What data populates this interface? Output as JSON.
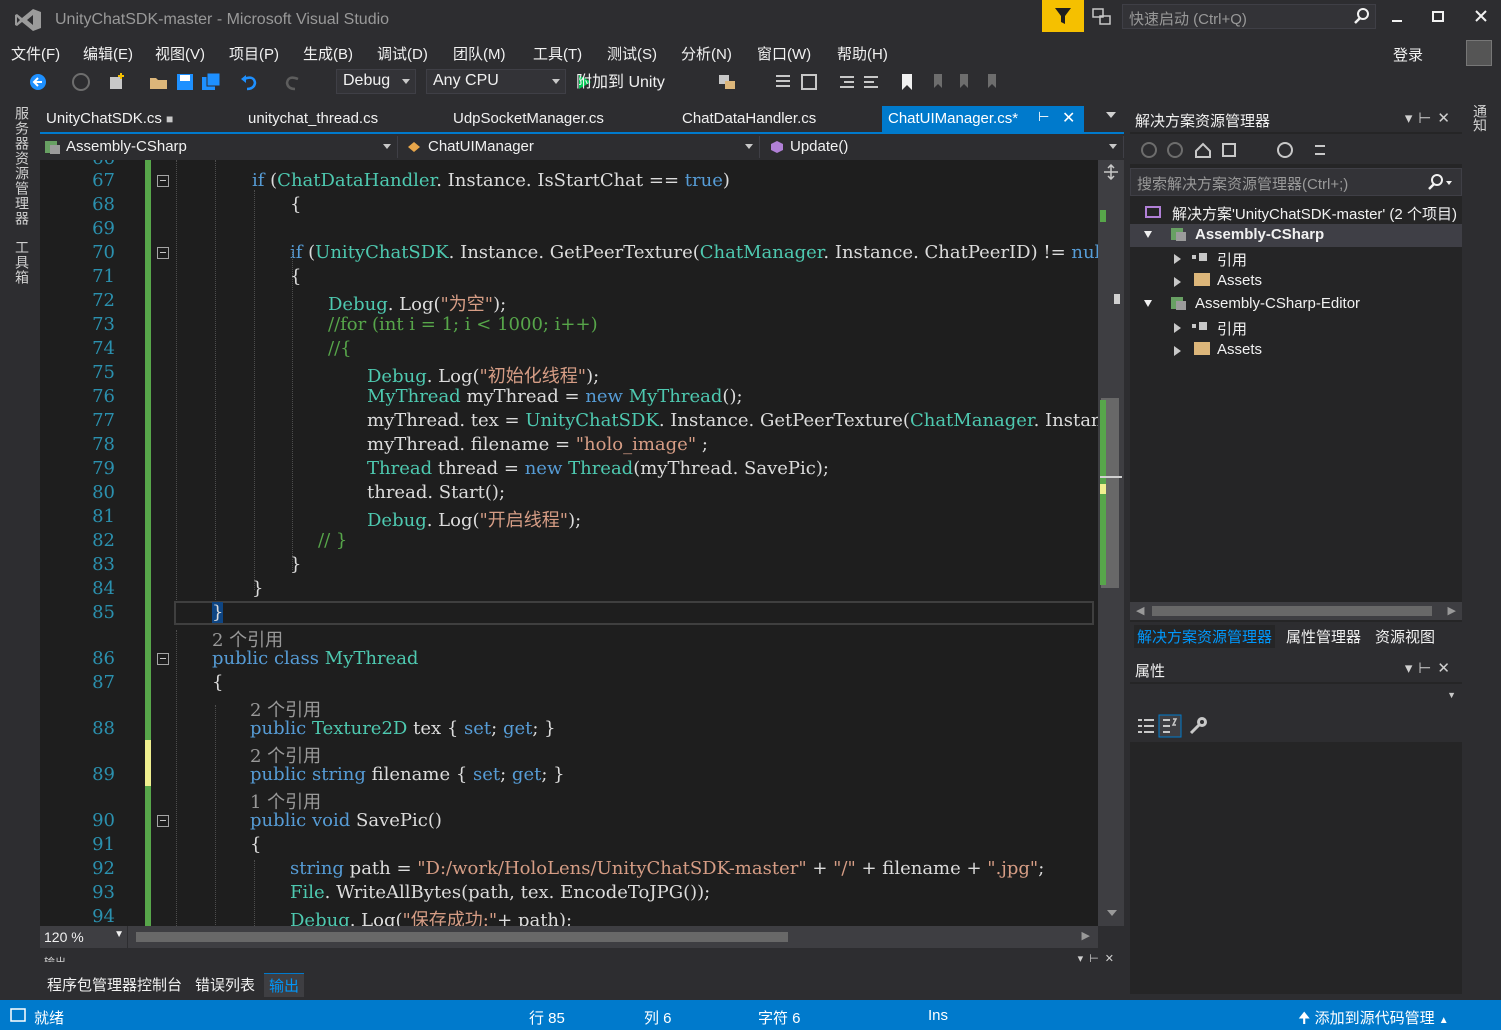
{
  "window": {
    "title": "UnityChatSDK-master - Microsoft Visual Studio",
    "quick_launch_placeholder": "快速启动 (Ctrl+Q)",
    "login": "登录"
  },
  "menu": [
    "文件(F)",
    "编辑(E)",
    "视图(V)",
    "项目(P)",
    "生成(B)",
    "调试(D)",
    "团队(M)",
    "工具(T)",
    "测试(S)",
    "分析(N)",
    "窗口(W)",
    "帮助(H)"
  ],
  "toolbar": {
    "config": "Debug",
    "platform": "Any CPU",
    "attach_label": "附加到 Unity"
  },
  "left_tabs": [
    "服务器资源管理器",
    "工具箱"
  ],
  "right_tab": "通知",
  "tabs": [
    {
      "label": "UnityChatSDK.cs"
    },
    {
      "label": "unitychat_thread.cs"
    },
    {
      "label": "UdpSocketManager.cs"
    },
    {
      "label": "ChatDataHandler.cs"
    },
    {
      "label": "ChatUIManager.cs*"
    }
  ],
  "navbar": {
    "project": "Assembly-CSharp",
    "class": "ChatUIManager",
    "member": "Update()"
  },
  "code": {
    "top_partial_line": "66",
    "lines": [
      {
        "n": "67",
        "indent": 212,
        "html": "<span class=\"kw\">if</span> (<span class=\"ty\">ChatDataHandler</span>. Instance. IsStartChat == <span class=\"kw\">true</span>)"
      },
      {
        "n": "68",
        "indent": 250,
        "html": "{"
      },
      {
        "n": "69",
        "indent": 250,
        "html": ""
      },
      {
        "n": "70",
        "indent": 250,
        "html": "<span class=\"kw\">if</span> (<span class=\"ty\">UnityChatSDK</span>. Instance. GetPeerTexture(<span class=\"ty\">ChatManager</span>. Instance. ChatPeerID) != <span class=\"kw\">null</span>)"
      },
      {
        "n": "71",
        "indent": 250,
        "html": "{"
      },
      {
        "n": "72",
        "indent": 288,
        "html": "<span class=\"ty\">Debug</span>. Log(<span class=\"st\">\"为空\"</span>);"
      },
      {
        "n": "73",
        "indent": 288,
        "html": "<span class=\"cm\">//for (int i = 1; i &lt; 1000; i++)</span>"
      },
      {
        "n": "74",
        "indent": 288,
        "html": "<span class=\"cm\">//{</span>"
      },
      {
        "n": "75",
        "indent": 327,
        "html": "<span class=\"ty\">Debug</span>. Log(<span class=\"st\">\"初始化线程\"</span>);"
      },
      {
        "n": "76",
        "indent": 327,
        "html": "<span class=\"ty\">MyThread</span> myThread = <span class=\"kw\">new</span> <span class=\"ty\">MyThread</span>();"
      },
      {
        "n": "77",
        "indent": 327,
        "html": "myThread. tex = <span class=\"ty\">UnityChatSDK</span>. Instance. GetPeerTexture(<span class=\"ty\">ChatManager</span>. Instance. ChatPeerID);"
      },
      {
        "n": "78",
        "indent": 327,
        "html": "myThread. filename = <span class=\"st\">\"holo_image\"</span> ;"
      },
      {
        "n": "79",
        "indent": 327,
        "html": "<span class=\"ty\">Thread</span> thread = <span class=\"kw\">new</span> <span class=\"ty\">Thread</span>(myThread. SavePic);"
      },
      {
        "n": "80",
        "indent": 327,
        "html": "thread. Start();"
      },
      {
        "n": "81",
        "indent": 327,
        "html": "<span class=\"ty\">Debug</span>. Log(<span class=\"st\">\"开启线程\"</span>);"
      },
      {
        "n": "82",
        "indent": 278,
        "html": "<span class=\"cm\">// }</span>"
      },
      {
        "n": "83",
        "indent": 250,
        "html": "}"
      },
      {
        "n": "84",
        "indent": 212,
        "html": "}"
      },
      {
        "n": "85",
        "indent": 172,
        "html": "<span class=\"bracehl\">}</span>"
      },
      {
        "ref": "2 个引用",
        "indent": 172
      },
      {
        "n": "86",
        "indent": 172,
        "html": "<span class=\"kw\">public</span> <span class=\"kw\">class</span> <span class=\"ty\">MyThread</span>"
      },
      {
        "n": "87",
        "indent": 172,
        "html": "{"
      },
      {
        "ref": "2 个引用",
        "indent": 210
      },
      {
        "n": "88",
        "indent": 210,
        "html": "<span class=\"kw\">public</span> <span class=\"ty\">Texture2D</span> tex { <span class=\"kw\">set</span>; <span class=\"kw\">get</span>; }"
      },
      {
        "ref": "2 个引用",
        "indent": 210
      },
      {
        "n": "89",
        "indent": 210,
        "html": "<span class=\"kw\">public</span> <span class=\"kw\">string</span> filename { <span class=\"kw\">set</span>; <span class=\"kw\">get</span>; }"
      },
      {
        "ref": "1 个引用",
        "indent": 210
      },
      {
        "n": "90",
        "indent": 210,
        "html": "<span class=\"kw\">public</span> <span class=\"kw\">void</span> SavePic()"
      },
      {
        "n": "91",
        "indent": 210,
        "html": "{"
      },
      {
        "n": "92",
        "indent": 250,
        "html": "<span class=\"kw\">string</span> path = <span class=\"st\">\"D:/work/HoloLens/UnityChatSDK-master\"</span> + <span class=\"st\">\"/\"</span> + filename + <span class=\"st\">\".jpg\"</span>;"
      },
      {
        "n": "93",
        "indent": 250,
        "html": "<span class=\"ty\">File</span>. WriteAllBytes(path, tex. EncodeToJPG());"
      },
      {
        "n": "94",
        "indent": 250,
        "html": "<span class=\"ty\">Debug</span>. Log(<span class=\"st\">\"保存成功:\"</span>+ path);"
      }
    ]
  },
  "zoom": "120 %",
  "output_header": "输出",
  "bottom_tabs": [
    {
      "label": "程序包管理器控制台"
    },
    {
      "label": "错误列表"
    },
    {
      "label": "输出"
    }
  ],
  "solution_explorer": {
    "title": "解决方案资源管理器",
    "search_placeholder": "搜索解决方案资源管理器(Ctrl+;)",
    "tree": [
      {
        "label": "解决方案'UnityChatSDK-master' (2 个项目)"
      },
      {
        "label": "Assembly-CSharp"
      },
      {
        "label": "引用"
      },
      {
        "label": "Assets"
      },
      {
        "label": "Assembly-CSharp-Editor"
      },
      {
        "label": "引用"
      },
      {
        "label": "Assets"
      }
    ],
    "tabs": [
      "解决方案资源管理器",
      "属性管理器",
      "资源视图"
    ]
  },
  "properties": {
    "title": "属性"
  },
  "status": {
    "ready": "就绪",
    "line": "行 85",
    "col": "列 6",
    "ch": "字符 6",
    "ins": "Ins",
    "source_control": "添加到源代码管理"
  },
  "colors": {
    "accent": "#007acc",
    "keyword": "#569cd6",
    "type": "#4ec9b0",
    "string": "#d69d85",
    "comment": "#57a64a",
    "line_number": "#2b91af"
  }
}
